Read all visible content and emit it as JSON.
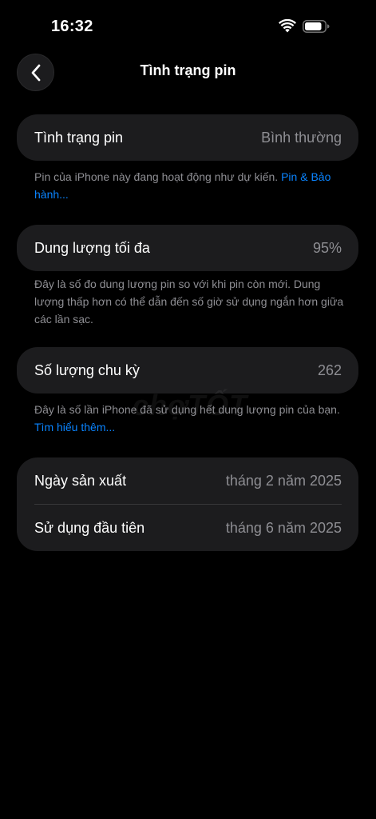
{
  "status_bar": {
    "time": "16:32",
    "icons": [
      "wifi-icon",
      "battery-icon"
    ]
  },
  "nav": {
    "back_icon": "chevron-left-icon",
    "title": "Tình trạng pin"
  },
  "battery_health": {
    "label": "Tình trạng pin",
    "value": "Bình thường",
    "footnote_text": "Pin của iPhone này đang hoạt động như dự kiến.",
    "footnote_link": "Pin & Bảo hành..."
  },
  "max_capacity": {
    "label": "Dung lượng tối đa",
    "value": "95%",
    "footnote_text": "Đây là số đo dung lượng pin so với khi pin còn mới. Dung lượng thấp hơn có thể dẫn đến số giờ sử dụng ngắn hơn giữa các lần sạc."
  },
  "cycle_count": {
    "label": "Số lượng chu kỳ",
    "value": "262",
    "footnote_text": "Đây là số lần iPhone đã sử dụng hết dung lượng pin của bạn.",
    "footnote_link": "Tìm hiểu thêm..."
  },
  "dates": {
    "manufacture_label": "Ngày sản xuất",
    "manufacture_value": "tháng 2 năm 2025",
    "first_use_label": "Sử dụng đầu tiên",
    "first_use_value": "tháng 6 năm 2025"
  },
  "watermark": "chợTỐT",
  "colors": {
    "background": "#000000",
    "card": "#1c1c1e",
    "secondary_text": "#8e8e93",
    "link": "#0a84ff",
    "divider": "#38383a"
  }
}
